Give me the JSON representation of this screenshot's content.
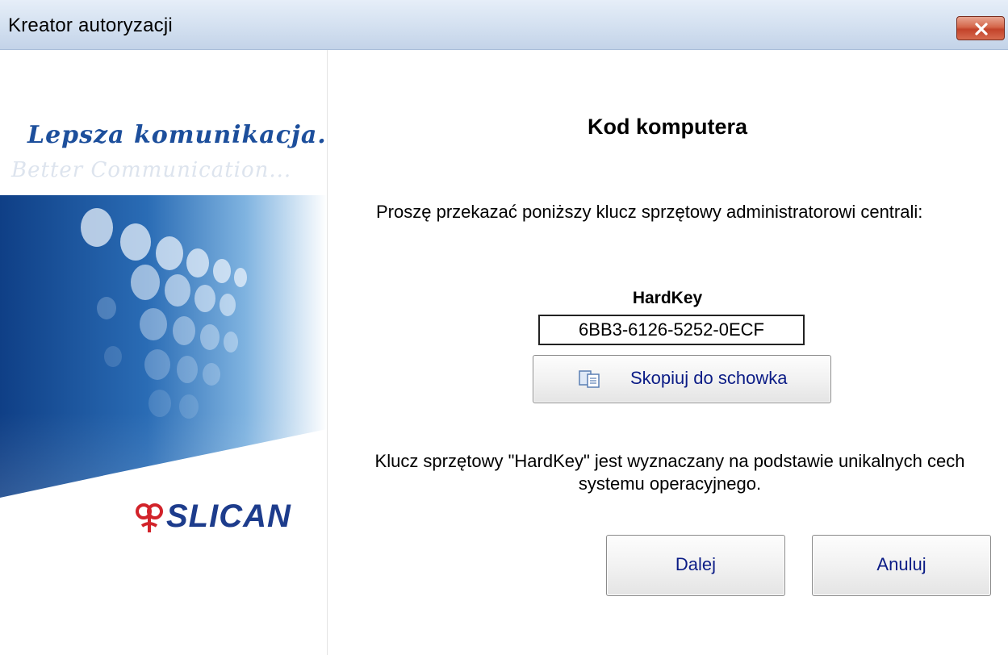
{
  "window": {
    "title": "Kreator autoryzacji",
    "close_icon": "close-icon"
  },
  "left_panel": {
    "tagline": "Lepsza komunikacja...",
    "tagline_sub": "Better Communication...",
    "logo_text": "SLICAN",
    "colors": {
      "brand_blue": "#1d4f9c",
      "logo_red": "#d2232a"
    }
  },
  "main": {
    "heading": "Kod komputera",
    "instruction": "Proszę przekazać poniższy klucz sprzętowy administratorowi centrali:",
    "hardkey_label": "HardKey",
    "hardkey_value": "6BB3-6126-5252-0ECF",
    "copy_button_label": "Skopiuj do schowka",
    "copy_icon": "copy-icon",
    "explanation": "Klucz sprzętowy \"HardKey\" jest wyznaczany na podstawie unikalnych cech systemu operacyjnego."
  },
  "buttons": {
    "next": "Dalej",
    "cancel": "Anuluj"
  }
}
